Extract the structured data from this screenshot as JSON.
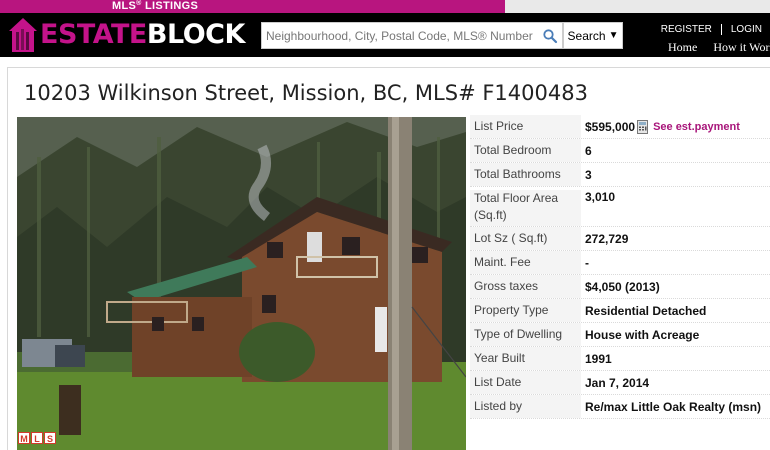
{
  "topbar": {
    "tab_label": "MLS",
    "tab_sup": "®",
    "tab_label2": " LISTINGS"
  },
  "header": {
    "logo_part1": "ESTATE",
    "logo_part2": "BLOCK",
    "search_placeholder": "Neighbourhood, City, Postal Code, MLS® Number",
    "search_button": "Search",
    "register": "REGISTER",
    "login": "LOGIN",
    "nav": [
      "Home",
      "How it Works"
    ]
  },
  "listing": {
    "title": "10203 Wilkinson Street, Mission, BC, MLS# F1400483",
    "details": [
      {
        "label": "List Price",
        "value": "$595,000",
        "link": "See est.payment"
      },
      {
        "label": "Total Bedroom",
        "value": "6"
      },
      {
        "label": "Total Bathrooms",
        "value": "3"
      },
      {
        "label": "Total Floor Area (Sq.ft)",
        "value": "3,010"
      },
      {
        "label": "Lot Sz ( Sq.ft)",
        "value": "272,729"
      },
      {
        "label": "Maint. Fee",
        "value": "-"
      },
      {
        "label": "Gross taxes",
        "value": "$4,050 (2013)"
      },
      {
        "label": "Property Type",
        "value": "Residential Detached"
      },
      {
        "label": "Type of Dwelling",
        "value": "House with Acreage"
      },
      {
        "label": "Year Built",
        "value": "1991"
      },
      {
        "label": "List Date",
        "value": "Jan 7, 2014"
      },
      {
        "label": "Listed by",
        "value": "Re/max Little Oak Realty (msn)"
      }
    ],
    "badge": [
      "M",
      "L",
      "S"
    ]
  },
  "colors": {
    "brand": "#b8157f",
    "header_bg": "#000000",
    "link": "#a8157a"
  }
}
